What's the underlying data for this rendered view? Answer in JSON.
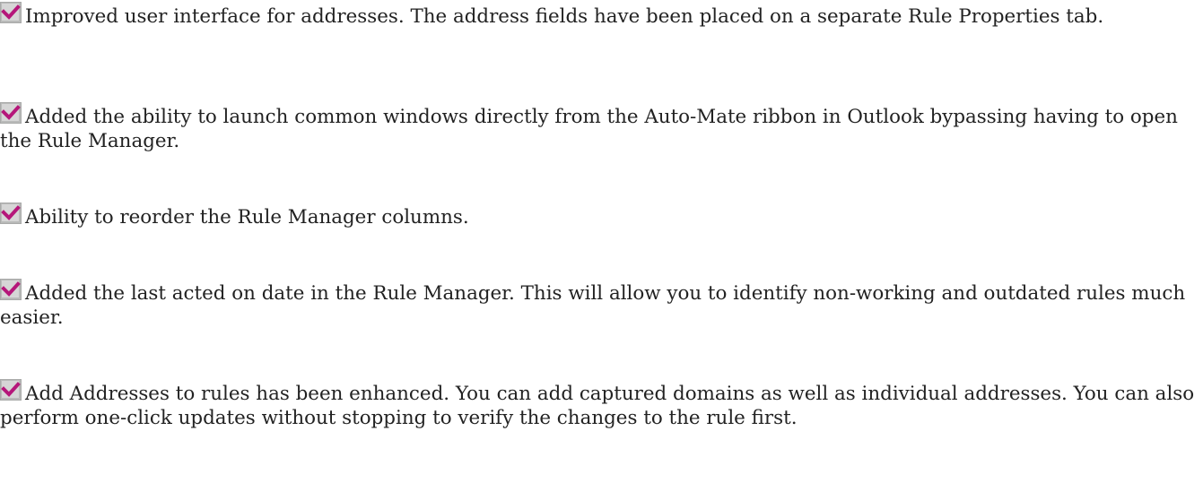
{
  "icon": {
    "name": "checked-checkbox-icon",
    "box_color": "#a9aaa9",
    "box_light": "#d6d6d6",
    "check_color": "#b5177a"
  },
  "features": [
    {
      "text": "Improved user interface for addresses. The address fields have been placed on a separate Rule Properties tab."
    },
    {
      "text": "Added the ability to launch common windows directly from the Auto-Mate ribbon in Outlook bypassing having to open the Rule Manager."
    },
    {
      "text": "Ability to reorder the Rule Manager columns."
    },
    {
      "text": "Added the last acted on date in the Rule Manager. This will allow you to identify non-working and outdated rules much easier."
    },
    {
      "text": "Add Addresses to rules has been enhanced. You can add captured domains as well as individual addresses. You can also perform one-click updates without stopping to verify the changes to the rule first."
    }
  ]
}
